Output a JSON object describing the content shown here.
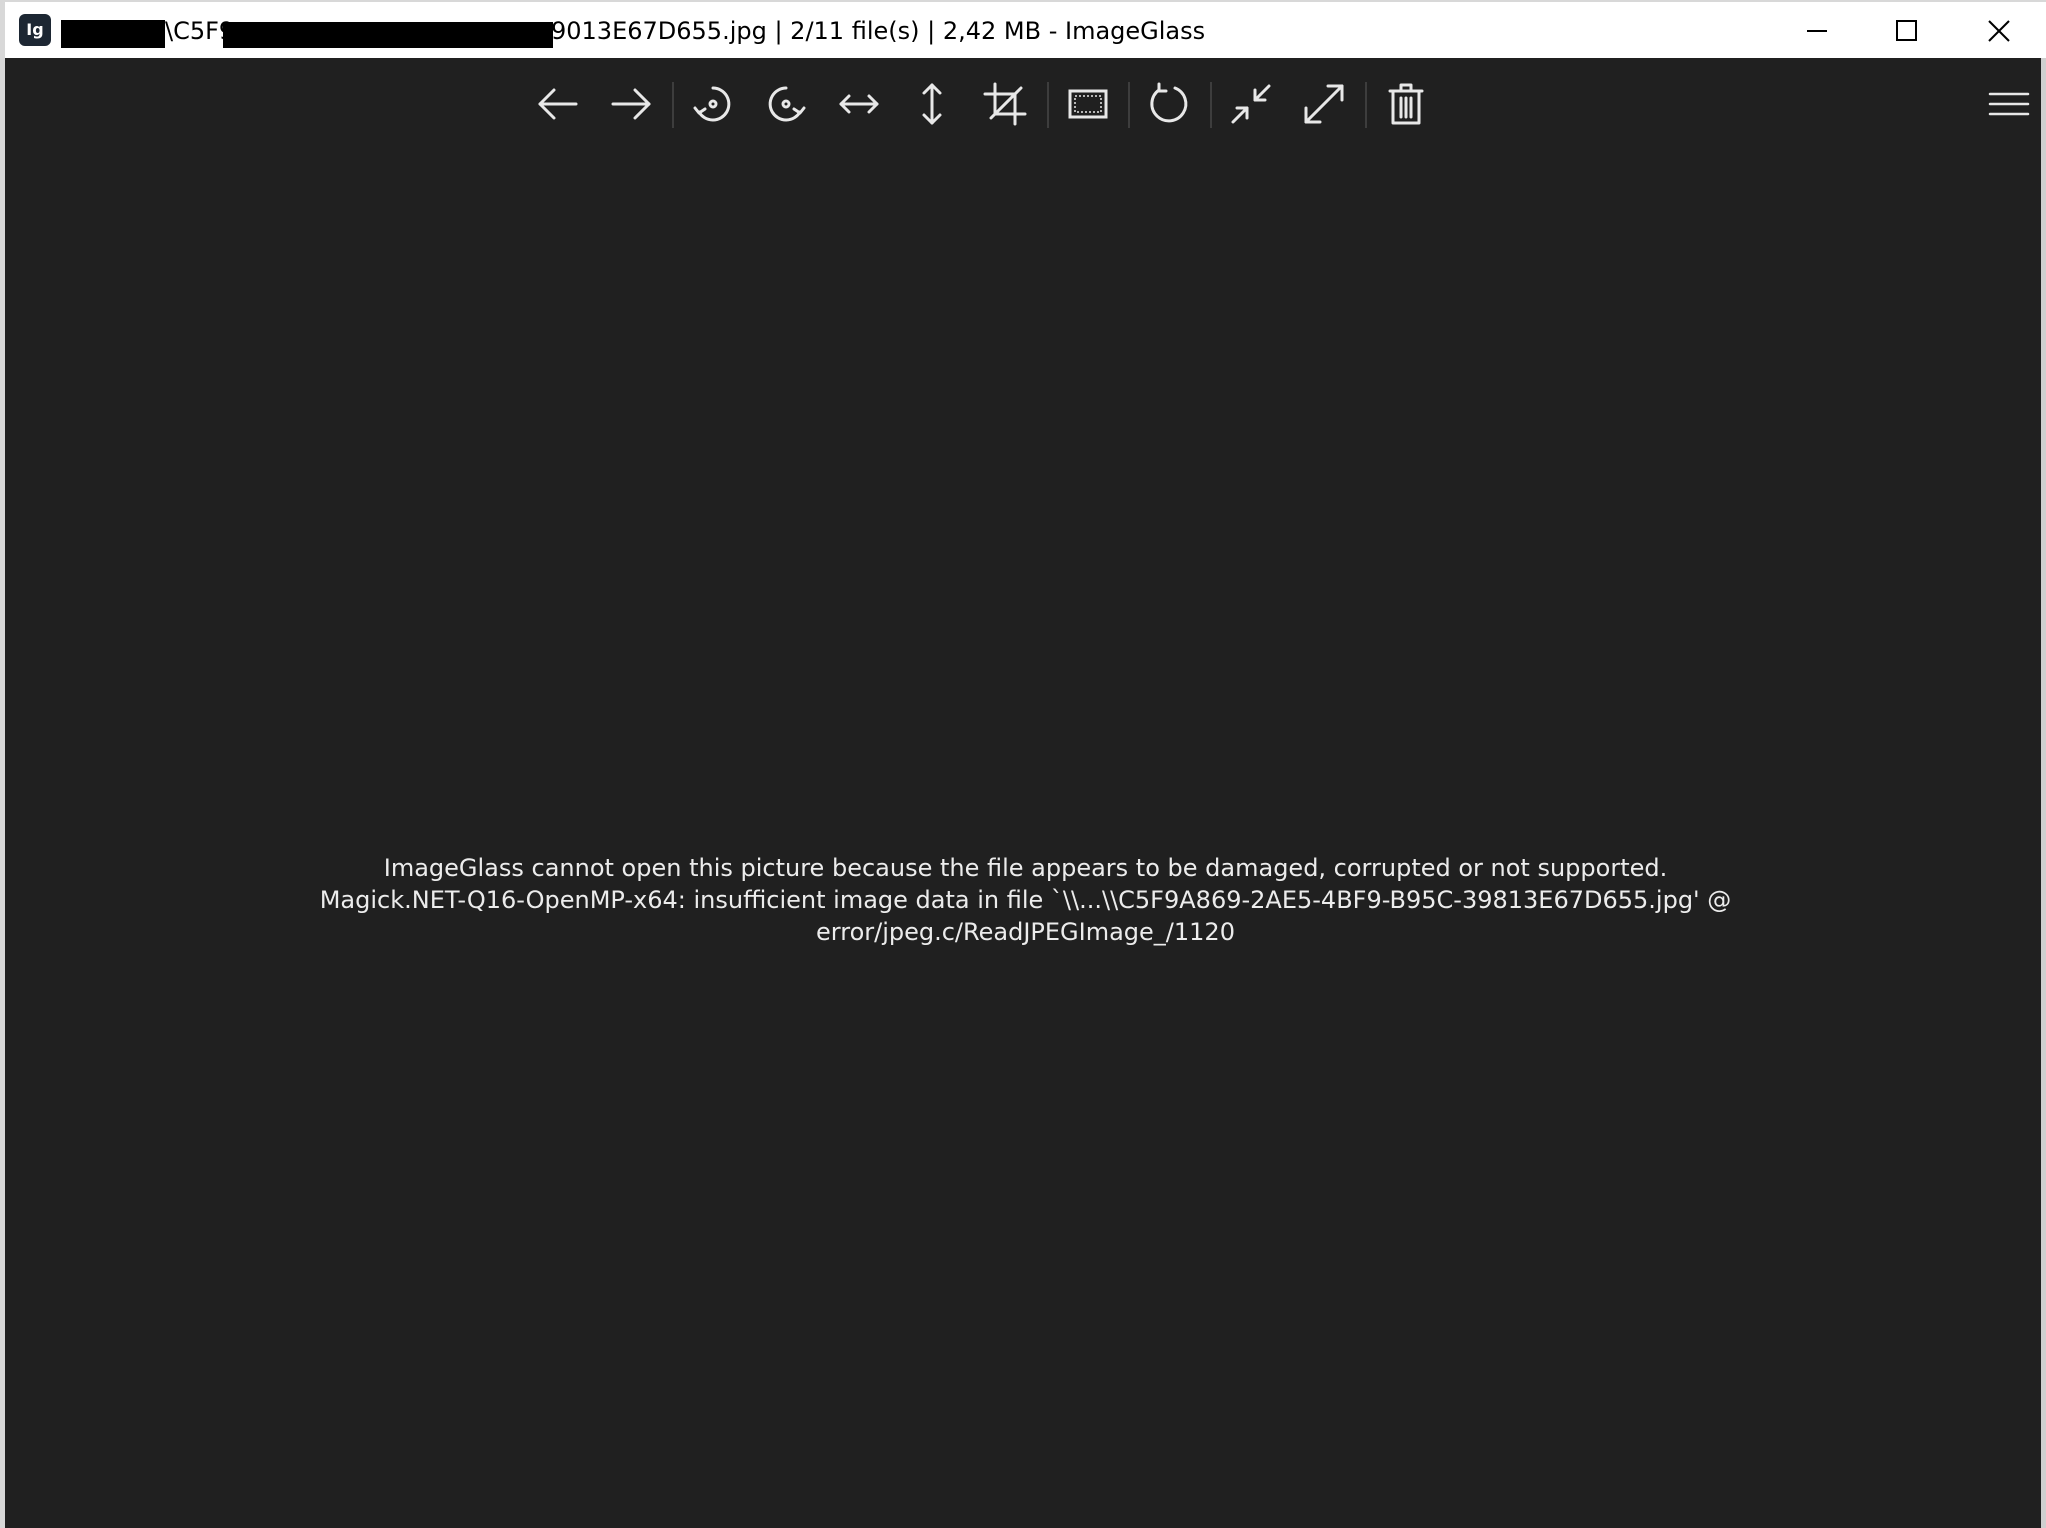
{
  "window": {
    "title_prefix": "\\C5F9",
    "title_main": "9013E67D655.jpg  |  2/11 file(s)  |  2,42 MB  - ImageGlass",
    "app_icon_text": "Ig",
    "controls": {
      "minimize_icon": "minimize-icon",
      "maximize_icon": "maximize-icon",
      "close_icon": "close-icon"
    }
  },
  "toolbar": {
    "buttons": [
      {
        "name": "previous-image-button",
        "icon": "arrow-left-icon"
      },
      {
        "name": "next-image-button",
        "icon": "arrow-right-icon"
      },
      {
        "name": "rotate-left-button",
        "icon": "rotate-left-icon"
      },
      {
        "name": "rotate-right-button",
        "icon": "rotate-right-icon"
      },
      {
        "name": "flip-horizontal-button",
        "icon": "flip-horizontal-icon"
      },
      {
        "name": "flip-vertical-button",
        "icon": "flip-vertical-icon"
      },
      {
        "name": "crop-button",
        "icon": "crop-icon"
      },
      {
        "name": "select-region-button",
        "icon": "selection-icon"
      },
      {
        "name": "refresh-button",
        "icon": "refresh-icon"
      },
      {
        "name": "zoom-to-fit-button",
        "icon": "collapse-icon"
      },
      {
        "name": "fullscreen-button",
        "icon": "expand-icon"
      },
      {
        "name": "delete-button",
        "icon": "trash-icon"
      },
      {
        "name": "main-menu-button",
        "icon": "hamburger-menu-icon"
      }
    ]
  },
  "viewer": {
    "error_line1": "ImageGlass cannot open this picture because the file appears to be damaged, corrupted or not supported.",
    "error_line2": "Magick.NET-Q16-OpenMP-x64: insufficient image data in file `\\\\...\\\\C5F9A869-2AE5-4BF9-B95C-39813E67D655.jpg' @",
    "error_line3": "error/jpeg.c/ReadJPEGImage_/1120"
  },
  "colors": {
    "background": "#202020",
    "titlebar": "#ffffff",
    "icon": "#e8e8e8",
    "text": "#ececec"
  }
}
